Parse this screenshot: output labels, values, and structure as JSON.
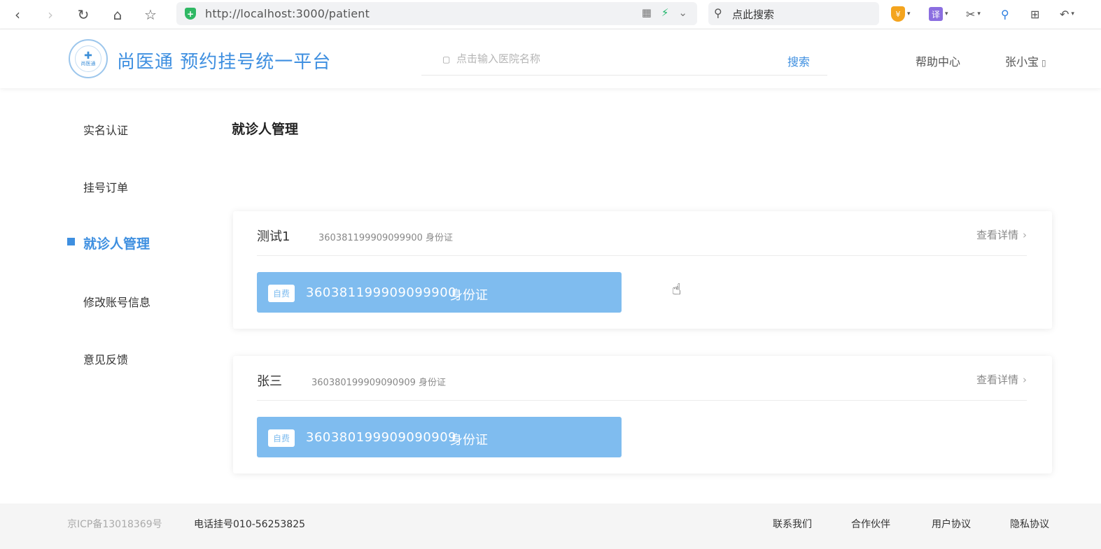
{
  "browser": {
    "url": "http://localhost:3000/patient",
    "search_placeholder": "点此搜索"
  },
  "header": {
    "logo_text": "尚医通",
    "brand": "尚医通 预约挂号统一平台",
    "search_placeholder": "点击输入医院名称",
    "search_button": "搜索",
    "help": "帮助中心",
    "user": "张小宝"
  },
  "sidebar": {
    "items": [
      {
        "label": "实名认证"
      },
      {
        "label": "挂号订单"
      },
      {
        "label": "就诊人管理"
      },
      {
        "label": "修改账号信息"
      },
      {
        "label": "意见反馈"
      }
    ],
    "active_index": 2
  },
  "main": {
    "title": "就诊人管理",
    "patients": [
      {
        "name": "测试1",
        "id_number": "360381199909099900",
        "id_type": "身份证",
        "detail": "查看详情",
        "tag": "自费"
      },
      {
        "name": "张三",
        "id_number": "360380199909090909",
        "id_type": "身份证",
        "detail": "查看详情",
        "tag": "自费"
      }
    ]
  },
  "footer": {
    "icp": "京ICP备13018369号",
    "phone": "电话挂号010-56253825",
    "links": [
      "联系我们",
      "合作伙伴",
      "用户协议",
      "隐私协议"
    ]
  },
  "colors": {
    "accent": "#3e8fe0",
    "id_box": "#7fbcef"
  }
}
